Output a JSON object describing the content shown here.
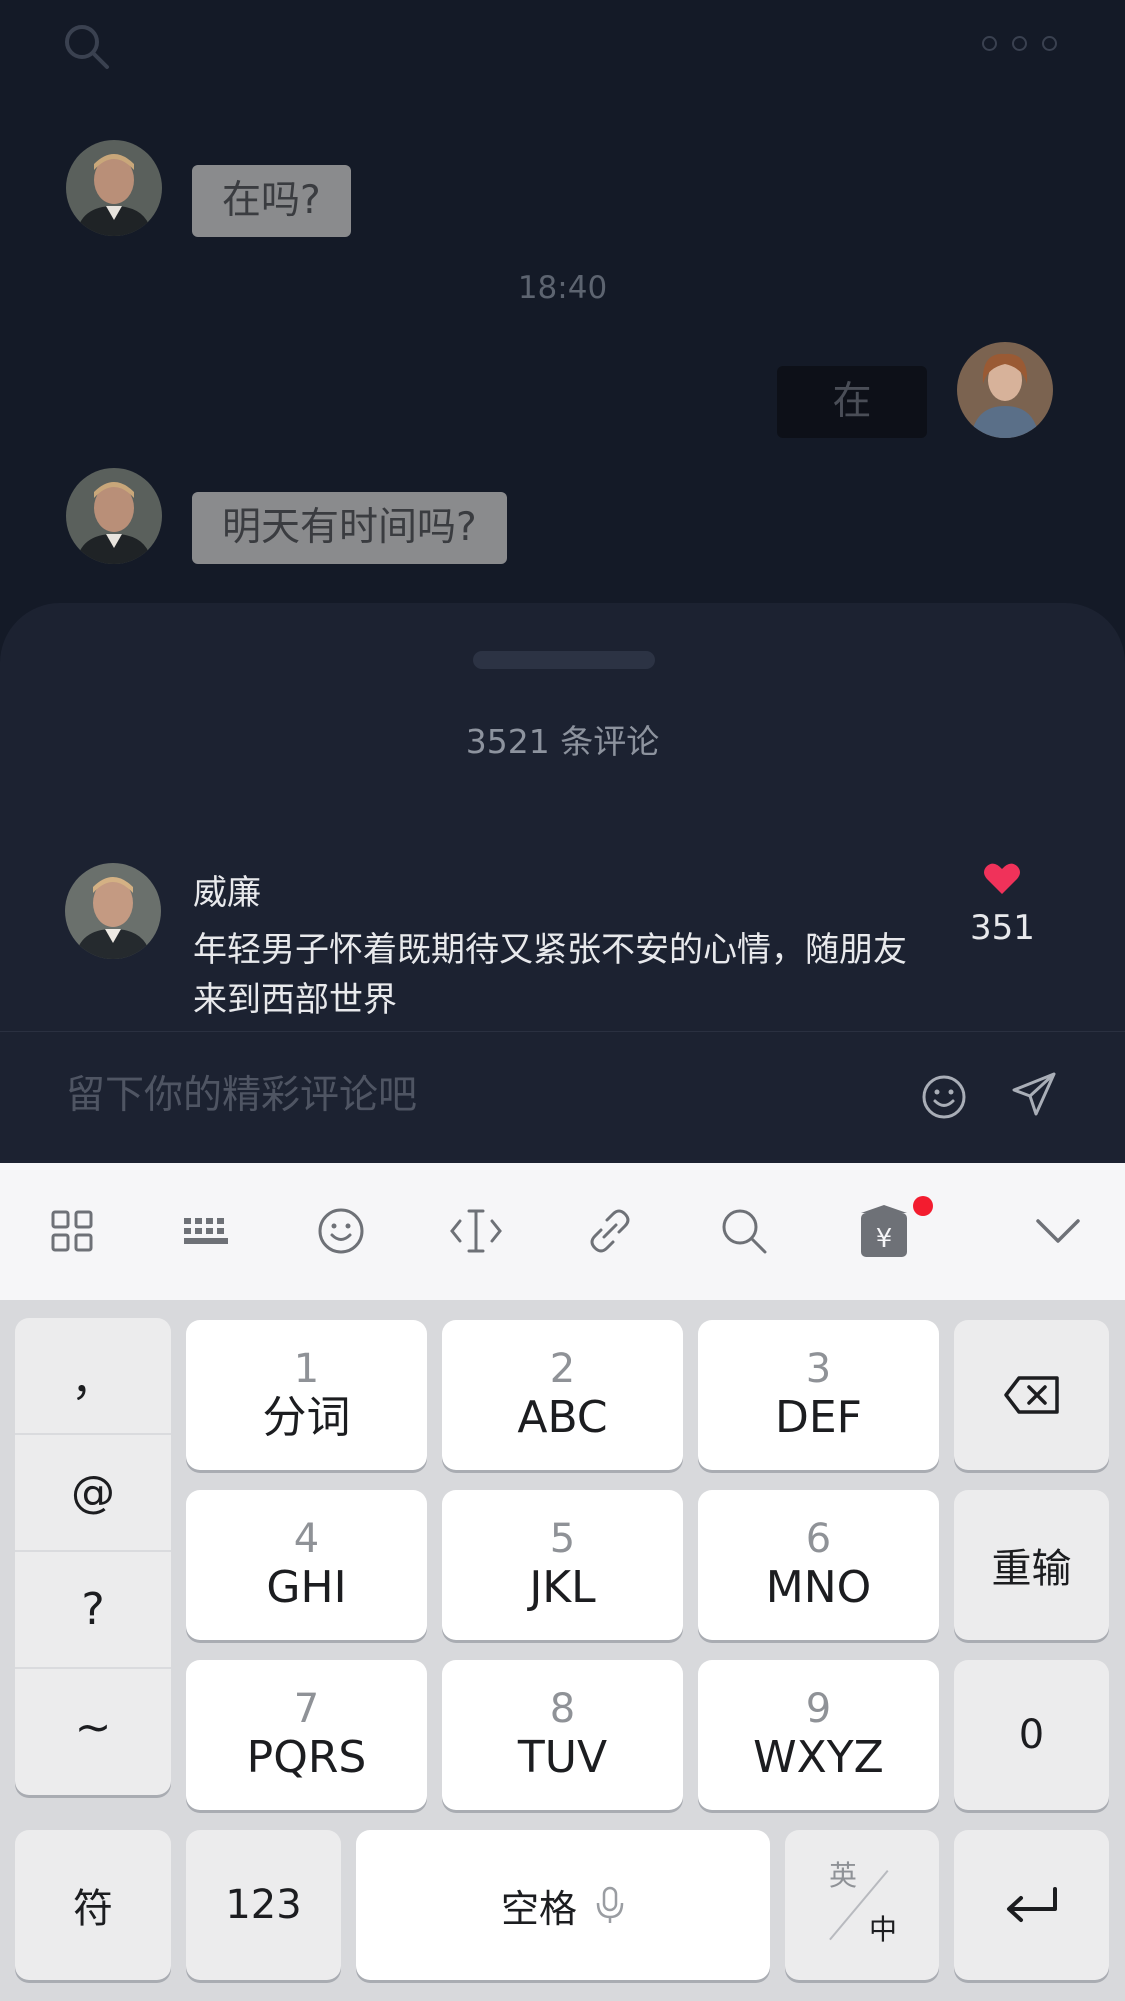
{
  "chat": {
    "messages": [
      {
        "side": "in",
        "text": "在吗?"
      },
      {
        "side": "out",
        "text": "在"
      },
      {
        "side": "in",
        "text": "明天有时间吗?"
      }
    ],
    "timestamp": "18:40"
  },
  "comments": {
    "title": "3521 条评论",
    "items": [
      {
        "author": "威廉",
        "text": "年轻男子怀着既期待又紧张不安的心情，随朋友来到西部世界",
        "likes": "351"
      }
    ],
    "input_placeholder": "留下你的精彩评论吧"
  },
  "keyboard": {
    "toolbar_icons": [
      "grid-icon",
      "keyboard-icon",
      "emoji-icon",
      "cursor-icon",
      "link-icon",
      "search-icon",
      "red-packet-icon",
      "collapse-icon"
    ],
    "symbols": [
      "，",
      "@",
      "?",
      "~"
    ],
    "keys": [
      {
        "num": "1",
        "letters": "分词"
      },
      {
        "num": "2",
        "letters": "ABC"
      },
      {
        "num": "3",
        "letters": "DEF"
      },
      {
        "num": "4",
        "letters": "GHI"
      },
      {
        "num": "5",
        "letters": "JKL"
      },
      {
        "num": "6",
        "letters": "MNO"
      },
      {
        "num": "7",
        "letters": "PQRS"
      },
      {
        "num": "8",
        "letters": "TUV"
      },
      {
        "num": "9",
        "letters": "WXYZ"
      }
    ],
    "retype": "重输",
    "zero": "0",
    "fu": "符",
    "num_mode": "123",
    "space": "空格",
    "lang_en": "英",
    "lang_zh": "中"
  },
  "colors": {
    "chat_bg": "#141a27",
    "sheet_bg": "#1c2231",
    "like": "#f0325a",
    "badge": "#f31c2f"
  }
}
